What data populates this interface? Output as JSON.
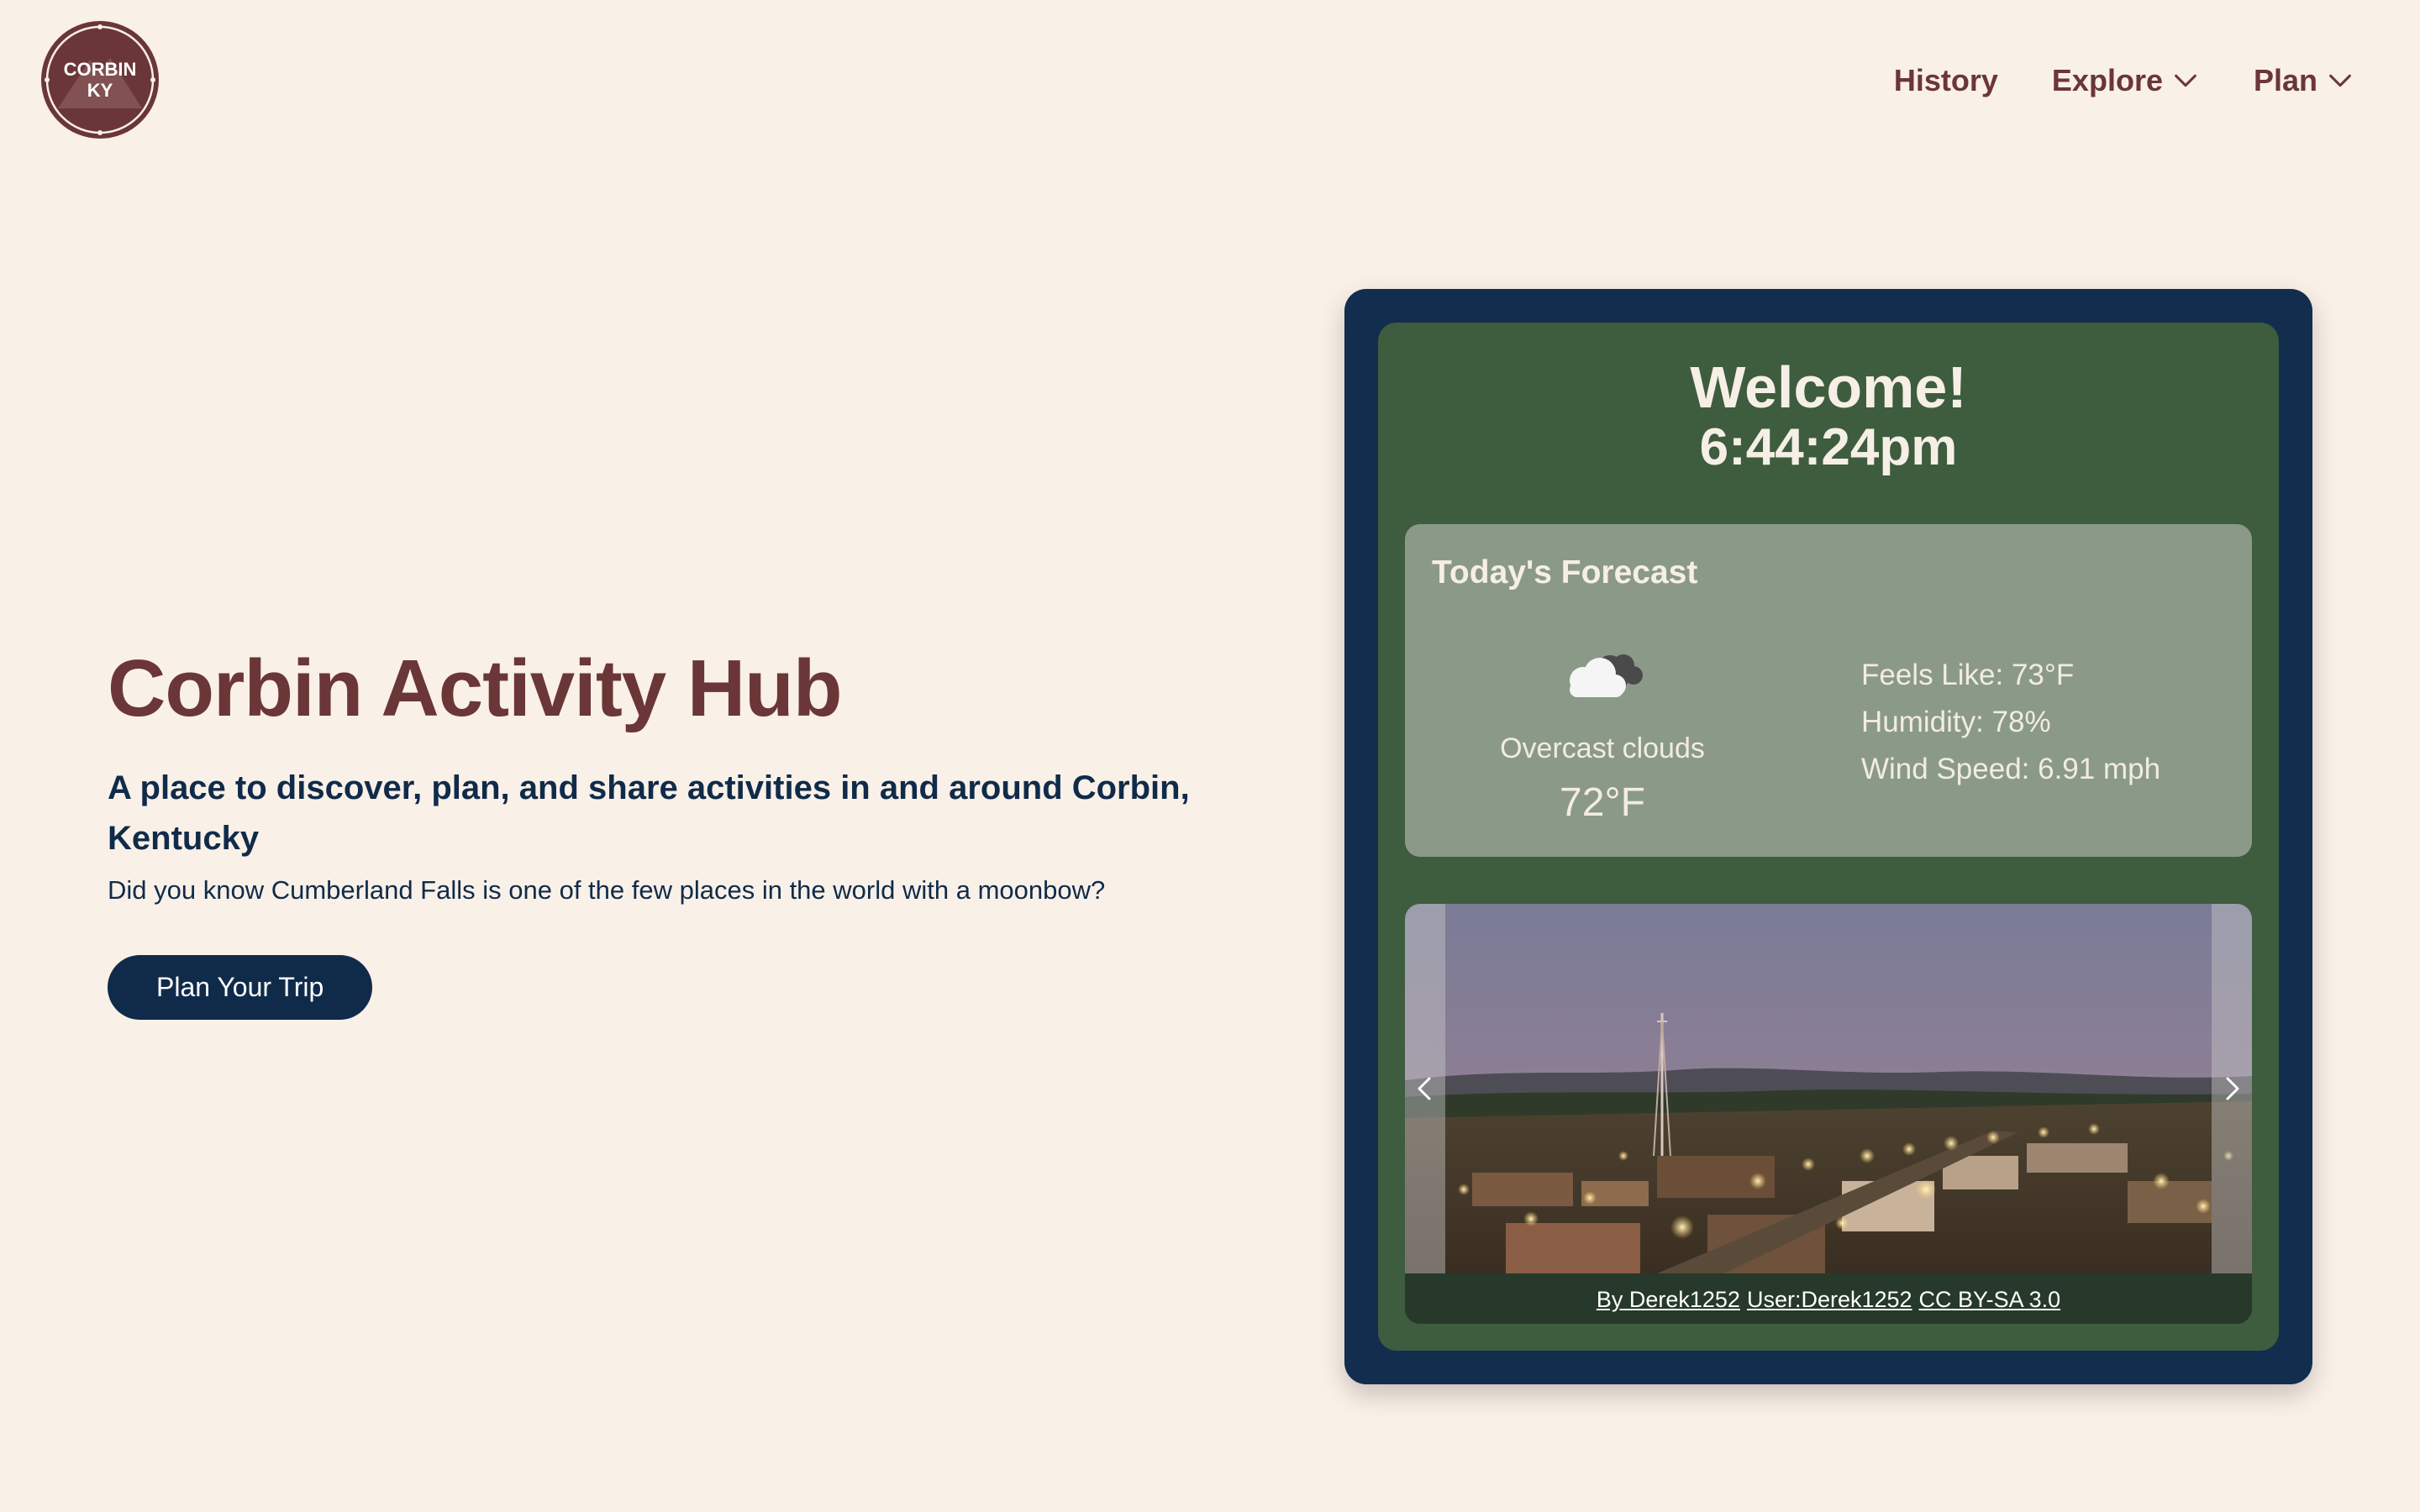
{
  "header": {
    "logo": {
      "line1": "CORBIN",
      "line2": "KY",
      "color": "#6b3637"
    },
    "nav": [
      {
        "label": "History",
        "has_dropdown": false
      },
      {
        "label": "Explore",
        "has_dropdown": true
      },
      {
        "label": "Plan",
        "has_dropdown": true
      }
    ]
  },
  "hero": {
    "title": "Corbin Activity Hub",
    "subtitle": "A place to discover, plan, and share activities in and around Corbin, Kentucky",
    "fact": "Did you know Cumberland Falls is one of the few places in the world with a moonbow?",
    "cta_label": "Plan Your Trip"
  },
  "widget": {
    "welcome": "Welcome!",
    "time": "6:44:24pm",
    "forecast": {
      "title": "Today's Forecast",
      "icon": "cloud-icon",
      "condition": "Overcast clouds",
      "temperature": "72°F",
      "feels_like": "Feels Like: 73°F",
      "humidity": "Humidity: 78%",
      "wind_speed": "Wind Speed: 6.91 mph"
    },
    "carousel": {
      "prev_icon": "chevron-left-icon",
      "next_icon": "chevron-right-icon",
      "photo_alt": "Corbin town at dusk",
      "credit": {
        "author": "By Derek1252",
        "user": "User:Derek1252",
        "license": "CC BY-SA 3.0"
      }
    }
  },
  "colors": {
    "background": "#f9f0e7",
    "brand_maroon": "#6b3637",
    "navy": "#102b4a",
    "widget_frame": "#122d4d",
    "widget_green": "#3e5c3e",
    "forecast_panel": "#8b9a88"
  }
}
